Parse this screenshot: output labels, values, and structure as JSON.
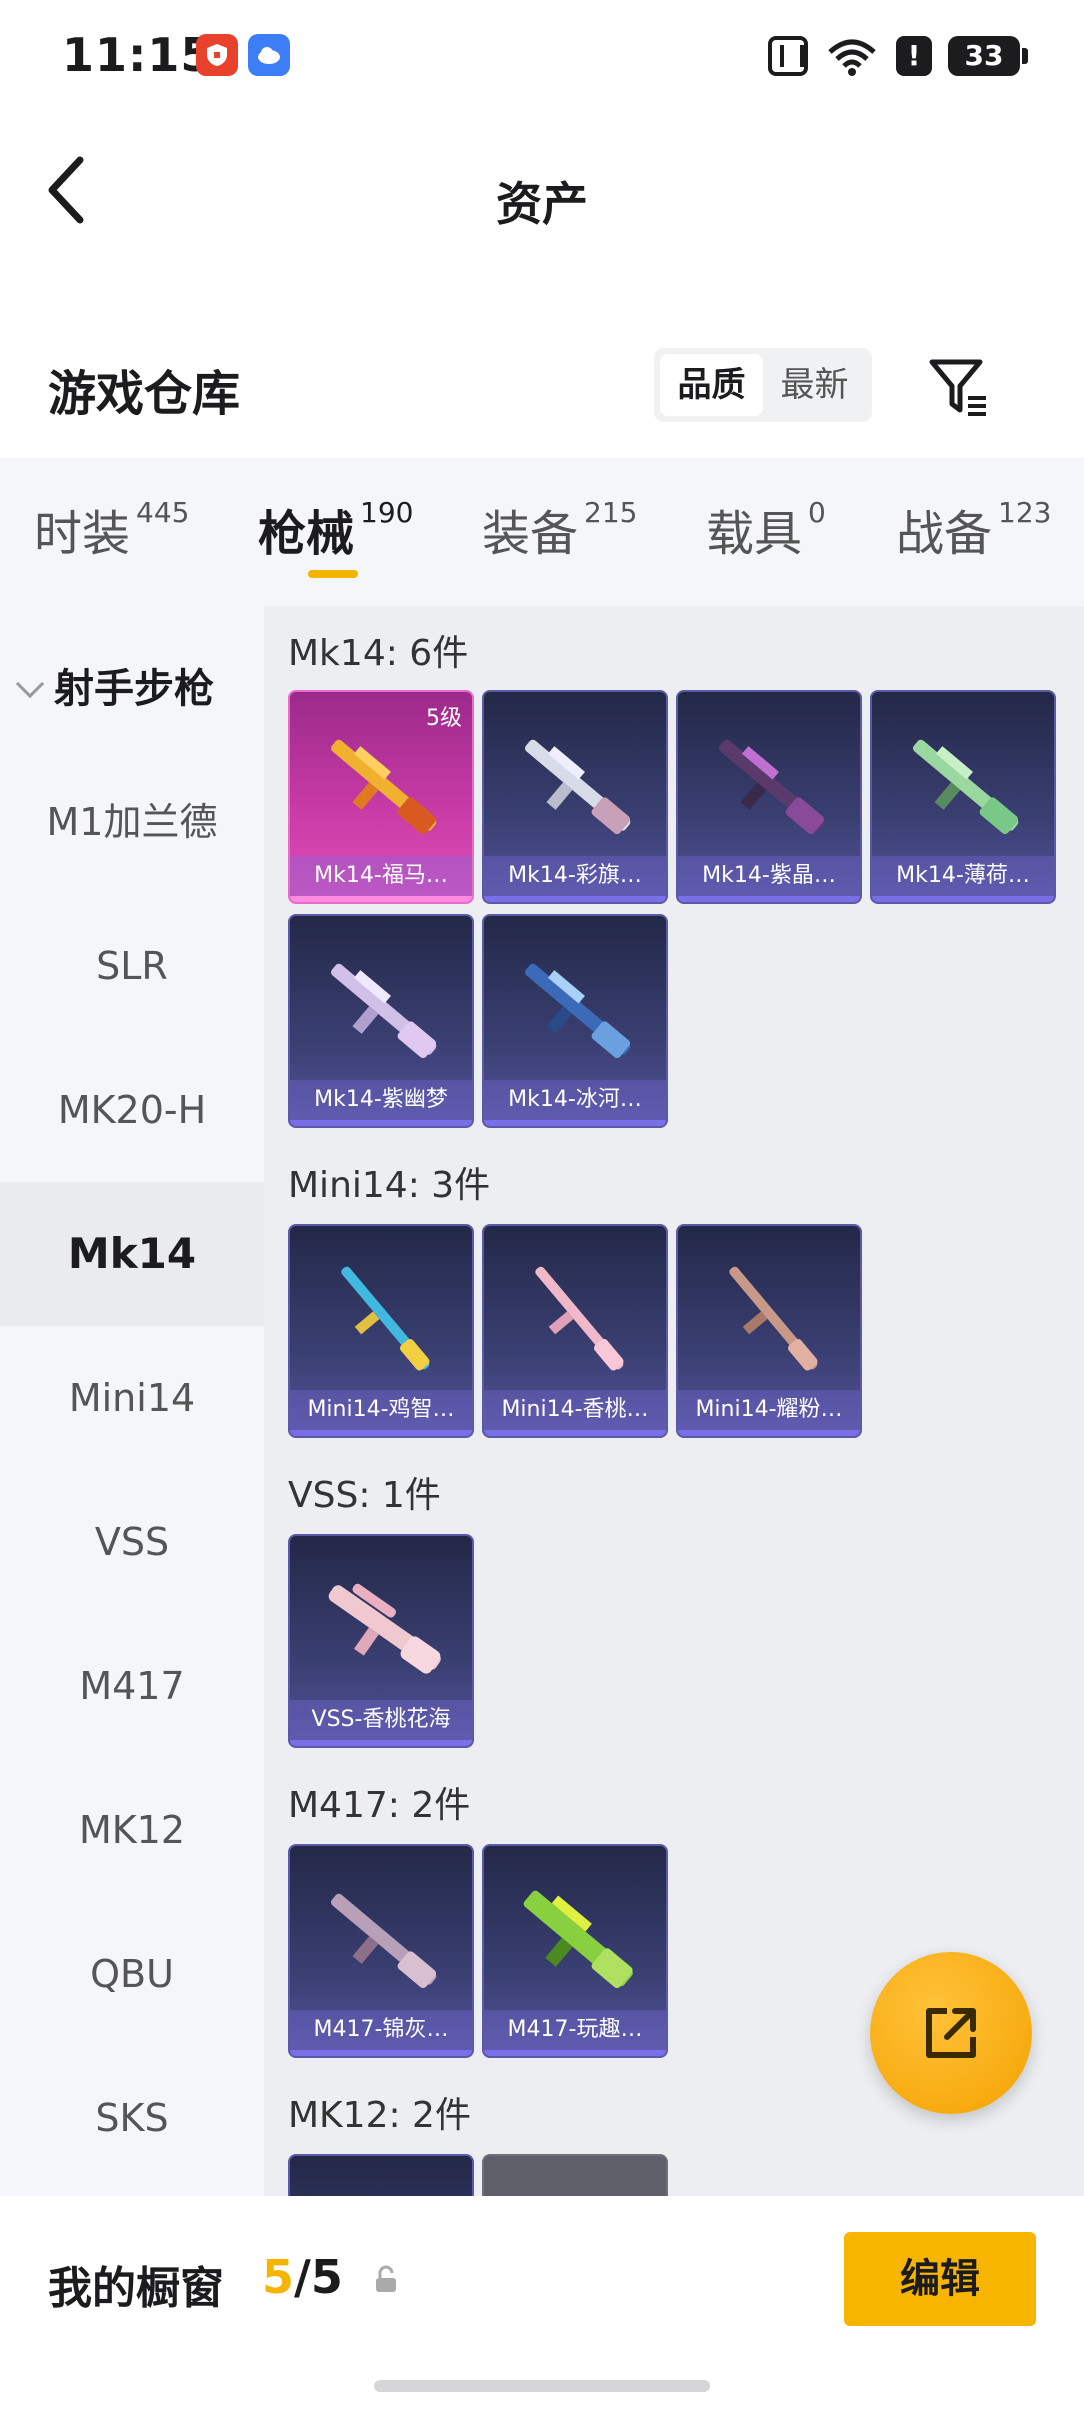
{
  "status_bar": {
    "time": "11:15",
    "battery": "33"
  },
  "header": {
    "title": "资产"
  },
  "warehouse": {
    "title": "游戏仓库",
    "sort_options": [
      "品质",
      "最新"
    ],
    "sort_selected": "品质"
  },
  "tabs": [
    {
      "label": "时装",
      "count": "445"
    },
    {
      "label": "枪械",
      "count": "190",
      "active": true
    },
    {
      "label": "装备",
      "count": "215"
    },
    {
      "label": "载具",
      "count": "0"
    },
    {
      "label": "战备",
      "count": "123"
    }
  ],
  "sidebar": {
    "group": "射手步枪",
    "items": [
      "M1加兰德",
      "SLR",
      "MK20-H",
      "Mk14",
      "Mini14",
      "VSS",
      "M417",
      "MK12",
      "QBU",
      "SKS"
    ],
    "active": "Mk14"
  },
  "sections": [
    {
      "title": "Mk14: 6件",
      "items": [
        {
          "name": "Mk14-福马…",
          "level": "5级"
        },
        {
          "name": "Mk14-彩旗…"
        },
        {
          "name": "Mk14-紫晶…"
        },
        {
          "name": "Mk14-薄荷…"
        },
        {
          "name": "Mk14-紫幽梦"
        },
        {
          "name": "Mk14-冰河…"
        }
      ]
    },
    {
      "title": "Mini14: 3件",
      "items": [
        {
          "name": "Mini14-鸡智…"
        },
        {
          "name": "Mini14-香桃…"
        },
        {
          "name": "Mini14-耀粉…"
        }
      ]
    },
    {
      "title": "VSS: 1件",
      "items": [
        {
          "name": "VSS-香桃花海"
        }
      ]
    },
    {
      "title": "M417: 2件",
      "items": [
        {
          "name": "M417-锦灰…"
        },
        {
          "name": "M417-玩趣…"
        }
      ]
    },
    {
      "title": "MK12: 2件",
      "items": []
    }
  ],
  "showcase": {
    "label": "我的橱窗",
    "current": "5",
    "total": "/5",
    "edit_label": "编辑"
  },
  "colors": {
    "accent": "#f5b400",
    "card_purple": "#3a3f72",
    "card_pink": "#c83aa6"
  }
}
